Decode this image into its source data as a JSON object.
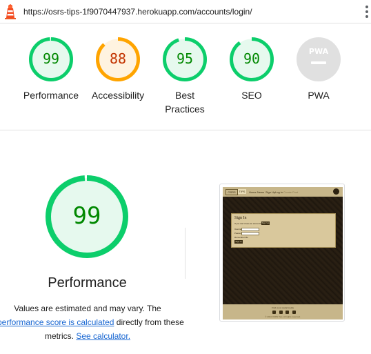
{
  "address_bar": {
    "url": "https://osrs-tips-1f9070447937.herokuapp.com/accounts/login/",
    "menu_icon": "kebab-menu-icon"
  },
  "colors": {
    "pass": "#0cce6b",
    "pass_text": "#008800",
    "pass_fill": "#e6f9ee",
    "average": "#ffa400",
    "average_text": "#c33300",
    "average_fill": "#fff3e0",
    "na": "#e0e0e0",
    "link": "#1967d2"
  },
  "categories": [
    {
      "id": "performance",
      "label_lines": [
        "Performance"
      ],
      "score": "99",
      "fraction": 0.99,
      "rating": "pass"
    },
    {
      "id": "accessibility",
      "label_lines": [
        "Accessibility"
      ],
      "score": "88",
      "fraction": 0.88,
      "rating": "average"
    },
    {
      "id": "best-practices",
      "label_lines": [
        "Best",
        "Practices"
      ],
      "score": "95",
      "fraction": 0.95,
      "rating": "pass"
    },
    {
      "id": "seo",
      "label_lines": [
        "SEO"
      ],
      "score": "90",
      "fraction": 0.9,
      "rating": "pass"
    },
    {
      "id": "pwa",
      "label_lines": [
        "PWA"
      ],
      "score": "",
      "badge_text": "PWA",
      "rating": "na"
    }
  ],
  "main": {
    "score": "99",
    "fraction": 0.99,
    "title": "Performance",
    "desc_text_1": "Values are estimated and may vary. The",
    "desc_link_1": "performance score is calculated",
    "desc_text_2": "directly from these",
    "desc_text_3": "metrics.",
    "desc_link_2": "See calculator."
  },
  "screenshot": {
    "nav_logo": "OSRS",
    "nav_tips": "TIPS",
    "nav_links": [
      "Home",
      "News",
      "Sign Up",
      "Log in",
      "Create Post"
    ],
    "card_title": "Sign In",
    "card_sub": "If you don't have an account?",
    "card_signup": "Sign Up",
    "username_label": "Username",
    "password_label": "Password",
    "remember_label": "Remember Me",
    "signin_button": "Sign In",
    "footer_text": "Find us on social media",
    "footer_copy": "© 2024 OSRS Tips. All rights reserved."
  }
}
